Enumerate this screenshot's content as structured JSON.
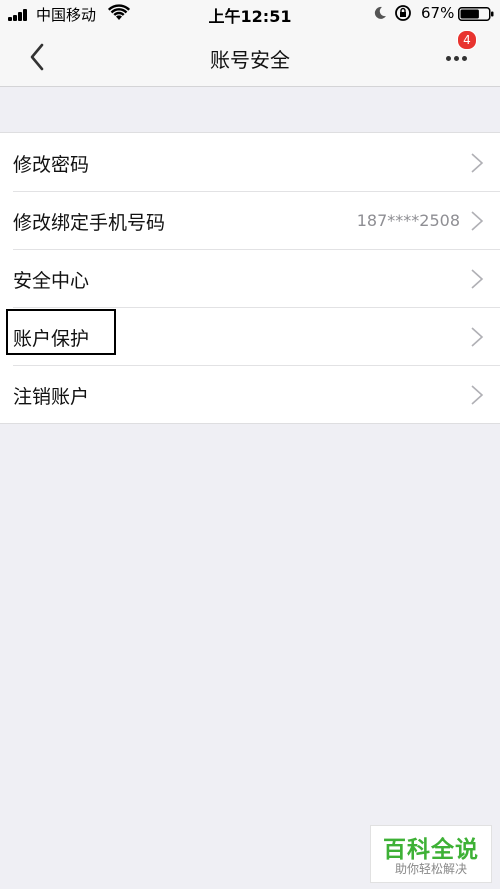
{
  "status_bar": {
    "carrier": "中国移动",
    "time": "上午12:51",
    "battery_percent": "67%",
    "battery_level": 0.67
  },
  "nav": {
    "title": "账号安全",
    "badge_count": "4"
  },
  "menu": {
    "items": [
      {
        "label": "修改密码",
        "value": ""
      },
      {
        "label": "修改绑定手机号码",
        "value": "187****2508"
      },
      {
        "label": "安全中心",
        "value": ""
      },
      {
        "label": "账户保护",
        "value": ""
      },
      {
        "label": "注销账户",
        "value": ""
      }
    ]
  },
  "watermark": {
    "main": "百科全说",
    "sub": "助你轻松解决"
  },
  "colors": {
    "background": "#efeff4",
    "badge": "#e8342f",
    "watermark_green": "#3eb136",
    "secondary_text": "#8e8e93"
  },
  "icons": [
    "signal-icon",
    "wifi-icon",
    "moon-icon",
    "rotation-lock-icon",
    "battery-icon",
    "back-arrow-icon",
    "more-dots-icon",
    "chevron-right-icon"
  ]
}
